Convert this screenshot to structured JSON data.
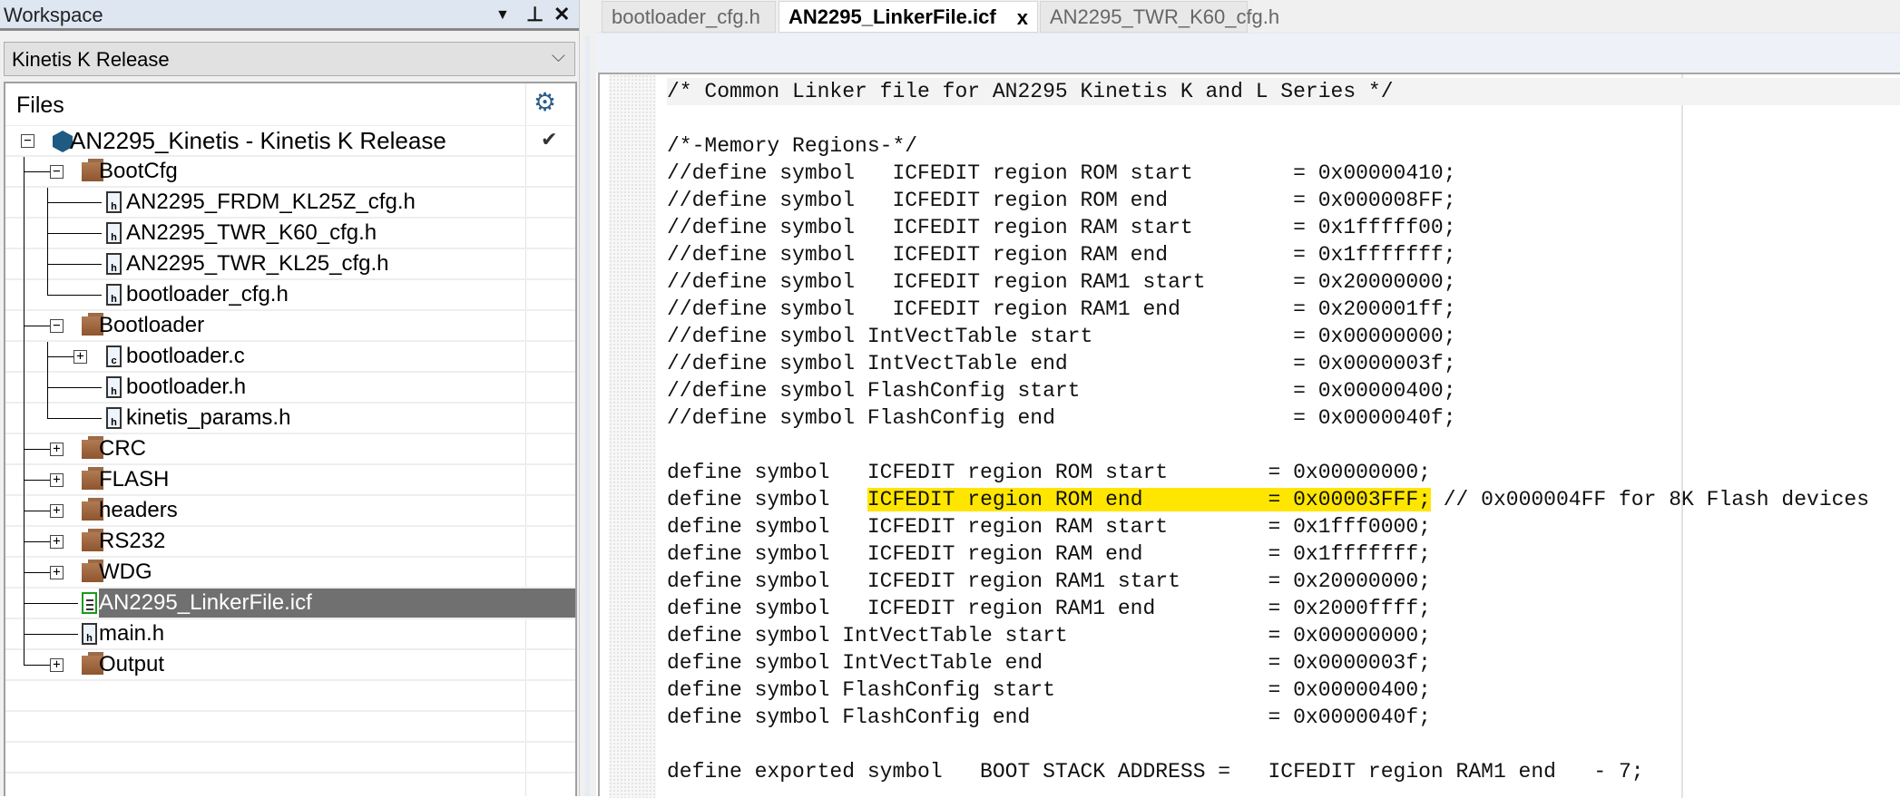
{
  "workspace": {
    "title": "Workspace",
    "buttons": {
      "menu": "▼",
      "pin": "⊥",
      "close": "✕"
    },
    "configuration": "Kinetis K Release",
    "files_header": "Files",
    "tree": [
      {
        "label": "AN2295_Kinetis - Kinetis K Release",
        "level": 0,
        "icon": "project-icon",
        "expander": "−",
        "check": "✔"
      },
      {
        "label": "BootCfg",
        "level": 1,
        "icon": "folder-icon",
        "expander": "−"
      },
      {
        "label": "AN2295_FRDM_KL25Z_cfg.h",
        "level": 2,
        "icon": "header-file-icon"
      },
      {
        "label": "AN2295_TWR_K60_cfg.h",
        "level": 2,
        "icon": "header-file-icon"
      },
      {
        "label": "AN2295_TWR_KL25_cfg.h",
        "level": 2,
        "icon": "header-file-icon"
      },
      {
        "label": "bootloader_cfg.h",
        "level": 2,
        "icon": "header-file-icon",
        "last": true
      },
      {
        "label": "Bootloader",
        "level": 1,
        "icon": "folder-icon",
        "expander": "−"
      },
      {
        "label": "bootloader.c",
        "level": 2,
        "icon": "c-file-icon",
        "expander": "+"
      },
      {
        "label": "bootloader.h",
        "level": 2,
        "icon": "header-file-icon"
      },
      {
        "label": "kinetis_params.h",
        "level": 2,
        "icon": "header-file-icon",
        "last": true
      },
      {
        "label": "CRC",
        "level": 1,
        "icon": "folder-icon",
        "expander": "+"
      },
      {
        "label": "FLASH",
        "level": 1,
        "icon": "folder-icon",
        "expander": "+"
      },
      {
        "label": "headers",
        "level": 1,
        "icon": "folder-icon",
        "expander": "+"
      },
      {
        "label": "RS232",
        "level": 1,
        "icon": "folder-icon",
        "expander": "+"
      },
      {
        "label": "WDG",
        "level": 1,
        "icon": "folder-icon",
        "expander": "+"
      },
      {
        "label": "AN2295_LinkerFile.icf",
        "level": 1,
        "icon": "icf-file-icon",
        "selected": true
      },
      {
        "label": "main.h",
        "level": 1,
        "icon": "header-file-icon"
      },
      {
        "label": "Output",
        "level": 1,
        "icon": "folder-icon",
        "expander": "+",
        "last": true
      }
    ]
  },
  "editor": {
    "tabs": [
      {
        "label": "bootloader_cfg.h",
        "active": false
      },
      {
        "label": "AN2295_LinkerFile.icf",
        "active": true,
        "close": "x"
      },
      {
        "label": "AN2295_TWR_K60_cfg.h",
        "active": false
      }
    ],
    "highlight_color": "#ffe600",
    "lines": [
      {
        "text": "/* Common Linker file for AN2295 Kinetis K and L Series */"
      },
      {
        "text": ""
      },
      {
        "text": "/*-Memory Regions-*/"
      },
      {
        "text": "//define symbol   ICFEDIT region ROM start        = 0x00000410;"
      },
      {
        "text": "//define symbol   ICFEDIT region ROM end          = 0x000008FF;"
      },
      {
        "text": "//define symbol   ICFEDIT region RAM start        = 0x1fffff00;"
      },
      {
        "text": "//define symbol   ICFEDIT region RAM end          = 0x1fffffff;"
      },
      {
        "text": "//define symbol   ICFEDIT region RAM1 start       = 0x20000000;"
      },
      {
        "text": "//define symbol   ICFEDIT region RAM1 end         = 0x200001ff;"
      },
      {
        "text": "//define symbol IntVectTable start                = 0x00000000;"
      },
      {
        "text": "//define symbol IntVectTable end                  = 0x0000003f;"
      },
      {
        "text": "//define symbol FlashConfig start                 = 0x00000400;"
      },
      {
        "text": "//define symbol FlashConfig end                   = 0x0000040f;"
      },
      {
        "text": ""
      },
      {
        "text": "define symbol   ICFEDIT region ROM start        = 0x00000000;"
      },
      {
        "text": "define symbol   ",
        "highlight": "ICFEDIT region ROM end          = 0x00003FFF;",
        "after": " // 0x000004FF for 8K Flash devices"
      },
      {
        "text": "define symbol   ICFEDIT region RAM start        = 0x1fff0000;"
      },
      {
        "text": "define symbol   ICFEDIT region RAM end          = 0x1fffffff;"
      },
      {
        "text": "define symbol   ICFEDIT region RAM1 start       = 0x20000000;"
      },
      {
        "text": "define symbol   ICFEDIT region RAM1 end         = 0x2000ffff;"
      },
      {
        "text": "define symbol IntVectTable start                = 0x00000000;"
      },
      {
        "text": "define symbol IntVectTable end                  = 0x0000003f;"
      },
      {
        "text": "define symbol FlashConfig start                 = 0x00000400;"
      },
      {
        "text": "define symbol FlashConfig end                   = 0x0000040f;"
      },
      {
        "text": ""
      },
      {
        "text": "define exported symbol   BOOT STACK ADDRESS =   ICFEDIT region RAM1 end   - 7;"
      }
    ]
  }
}
